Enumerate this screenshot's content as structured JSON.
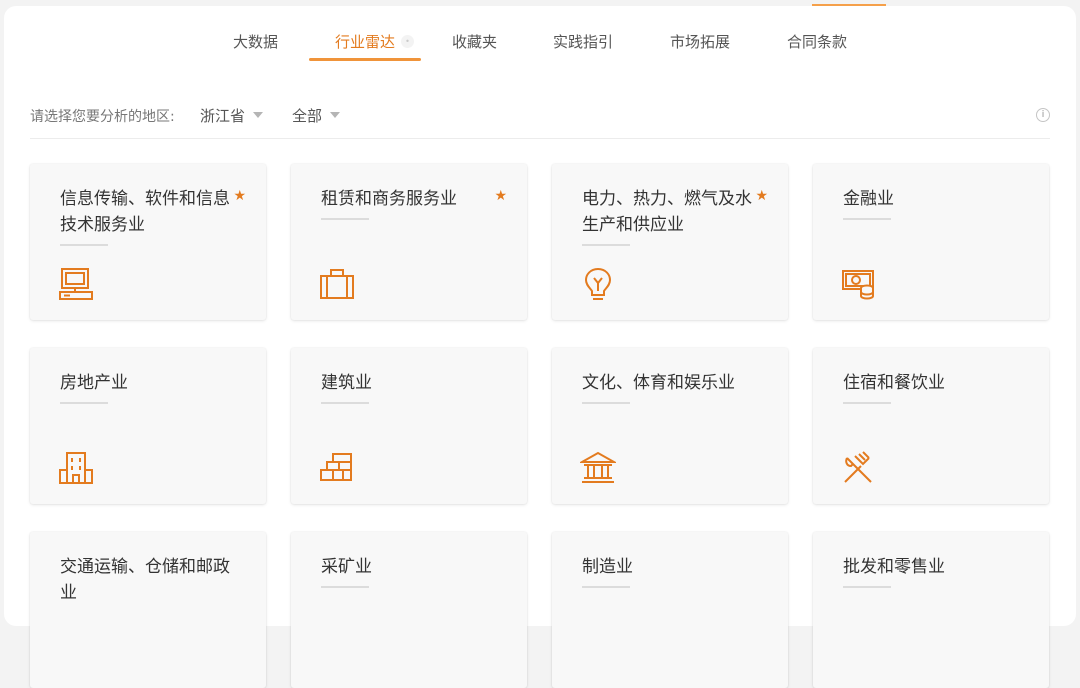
{
  "accent_color": "#e37b1f",
  "tabs": [
    {
      "label": "大数据",
      "active": false
    },
    {
      "label": "行业雷达",
      "active": true
    },
    {
      "label": "收藏夹",
      "active": false
    },
    {
      "label": "实践指引",
      "active": false
    },
    {
      "label": "市场拓展",
      "active": false
    },
    {
      "label": "合同条款",
      "active": false
    }
  ],
  "filter": {
    "label": "请选择您要分析的地区:",
    "province": "浙江省",
    "city": "全部"
  },
  "cards": [
    {
      "title": "信息传输、软件和信息技术服务业",
      "starred": true,
      "icon": "computer-icon"
    },
    {
      "title": "租赁和商务服务业",
      "starred": true,
      "icon": "briefcase-icon"
    },
    {
      "title": "电力、热力、燃气及水生产和供应业",
      "starred": true,
      "icon": "lightbulb-icon"
    },
    {
      "title": "金融业",
      "starred": false,
      "icon": "money-coins-icon"
    },
    {
      "title": "房地产业",
      "starred": false,
      "icon": "building-icon"
    },
    {
      "title": "建筑业",
      "starred": false,
      "icon": "bricks-icon"
    },
    {
      "title": "文化、体育和娱乐业",
      "starred": false,
      "icon": "museum-icon"
    },
    {
      "title": "住宿和餐饮业",
      "starred": false,
      "icon": "fork-knife-icon"
    },
    {
      "title": "交通运输、仓储和邮政业",
      "starred": false,
      "icon": "truck-icon"
    },
    {
      "title": "采矿业",
      "starred": false,
      "icon": "pickaxe-icon"
    },
    {
      "title": "制造业",
      "starred": false,
      "icon": "factory-icon"
    },
    {
      "title": "批发和零售业",
      "starred": false,
      "icon": "cart-icon"
    }
  ]
}
